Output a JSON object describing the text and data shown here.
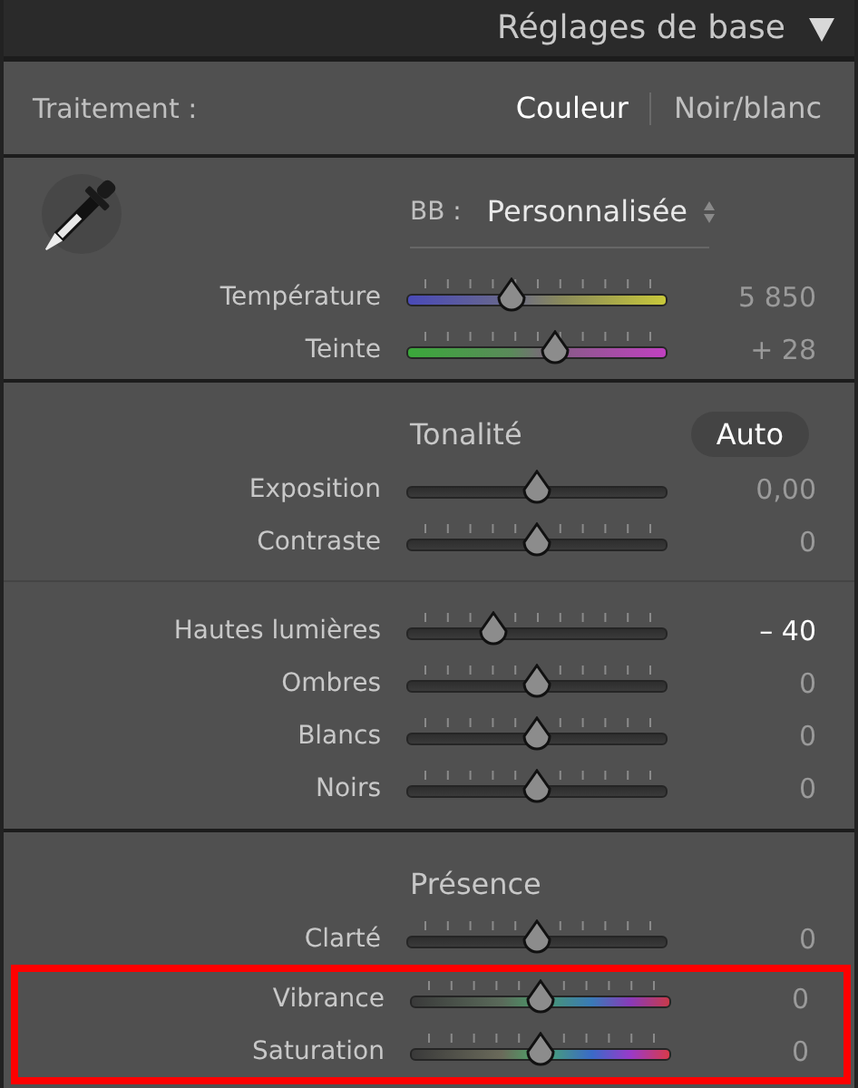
{
  "panel": {
    "title": "Réglages de base",
    "expanded": true
  },
  "treatment": {
    "label": "Traitement :",
    "options": [
      {
        "label": "Couleur",
        "selected": true
      },
      {
        "label": "Noir/blanc",
        "selected": false
      }
    ]
  },
  "sections": [
    {
      "kind": "white_balance",
      "wb_label": "BB :",
      "wb_value": "Personnalisée",
      "groups": [
        {
          "sliders": [
            {
              "label": "Température",
              "kind": "temperature",
              "ticks": true,
              "level": 0.4,
              "value": "5 850",
              "bright": false,
              "highlighted": false
            },
            {
              "label": "Teinte",
              "kind": "tint",
              "ticks": true,
              "level": 0.57,
              "value": "+ 28",
              "bright": false,
              "highlighted": false
            }
          ]
        }
      ]
    },
    {
      "kind": "tone",
      "heading": "Tonalité",
      "button": "Auto",
      "groups": [
        {
          "sliders": [
            {
              "label": "Exposition",
              "kind": "plain",
              "ticks": false,
              "level": 0.5,
              "value": "0,00",
              "bright": false,
              "highlighted": false
            },
            {
              "label": "Contraste",
              "kind": "plain",
              "ticks": true,
              "level": 0.5,
              "value": "0",
              "bright": false,
              "highlighted": false
            }
          ]
        },
        {
          "sliders": [
            {
              "label": "Hautes lumières",
              "kind": "plain",
              "ticks": true,
              "level": 0.33,
              "value": "– 40",
              "bright": true,
              "highlighted": false
            },
            {
              "label": "Ombres",
              "kind": "plain",
              "ticks": true,
              "level": 0.5,
              "value": "0",
              "bright": false,
              "highlighted": false
            },
            {
              "label": "Blancs",
              "kind": "plain",
              "ticks": true,
              "level": 0.5,
              "value": "0",
              "bright": false,
              "highlighted": false
            },
            {
              "label": "Noirs",
              "kind": "plain",
              "ticks": true,
              "level": 0.5,
              "value": "0",
              "bright": false,
              "highlighted": false
            }
          ]
        }
      ]
    },
    {
      "kind": "presence",
      "heading": "Présence",
      "groups": [
        {
          "sliders": [
            {
              "label": "Clarté",
              "kind": "plain",
              "ticks": true,
              "level": 0.5,
              "value": "0",
              "bright": false,
              "highlighted": false
            },
            {
              "label": "Vibrance",
              "kind": "vibrance",
              "ticks": true,
              "level": 0.5,
              "value": "0",
              "bright": false,
              "highlighted": true
            },
            {
              "label": "Saturation",
              "kind": "saturation",
              "ticks": true,
              "level": 0.5,
              "value": "0",
              "bright": false,
              "highlighted": true
            }
          ]
        }
      ]
    }
  ]
}
